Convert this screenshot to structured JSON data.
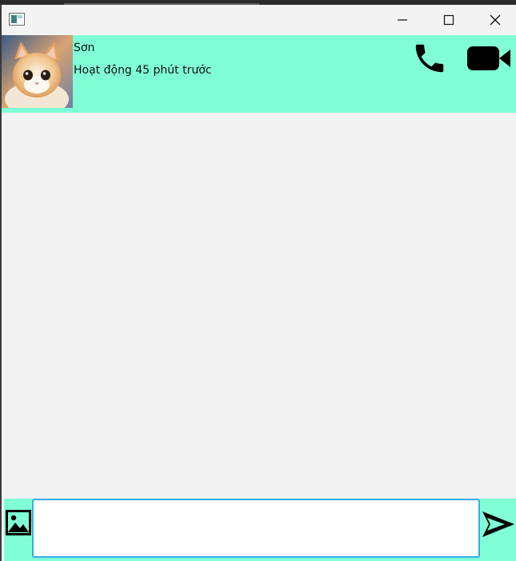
{
  "contact": {
    "name": "Sơn",
    "status": "Hoạt động 45 phút trước"
  },
  "message_input": {
    "value": "",
    "placeholder": ""
  },
  "colors": {
    "accent": "#80ffd6",
    "input_border": "#33aee6",
    "background": "#f3f3f3"
  },
  "icons": {
    "header": [
      "phone-icon",
      "video-camera-icon"
    ],
    "footer": [
      "image-icon",
      "send-icon"
    ],
    "window": [
      "minimize-icon",
      "maximize-icon",
      "close-icon"
    ]
  }
}
